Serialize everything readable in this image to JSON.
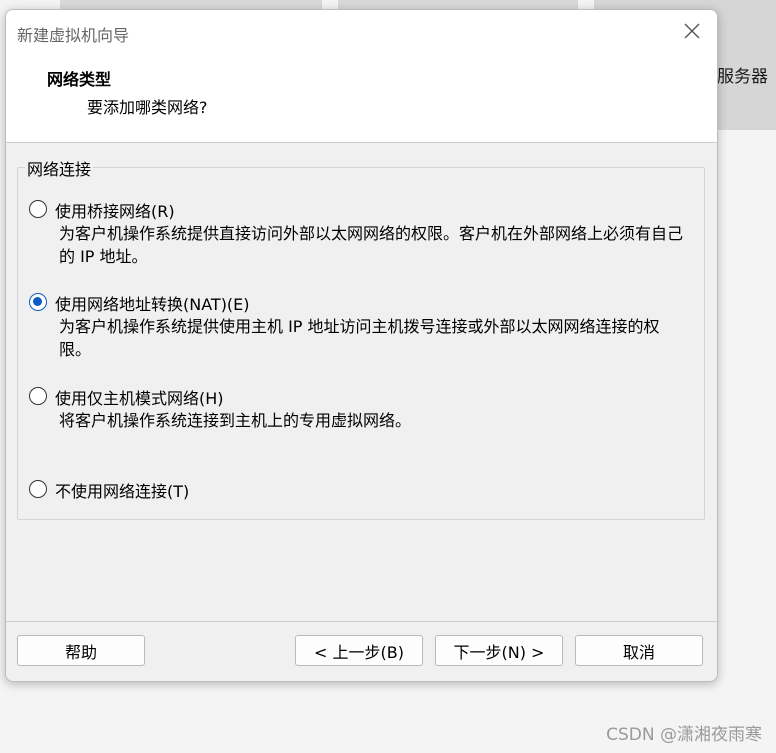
{
  "background": {
    "partial_label": "星服务器",
    "watermark": "CSDN @潇湘夜雨寒"
  },
  "dialog": {
    "title": "新建虚拟机向导",
    "header_title": "网络类型",
    "header_subtitle": "要添加哪类网络?",
    "group_label": "网络连接",
    "options": [
      {
        "label": "使用桥接网络(R)",
        "description": "为客户机操作系统提供直接访问外部以太网网络的权限。客户机在外部网络上必须有自己的 IP 地址。",
        "checked": false
      },
      {
        "label": "使用网络地址转换(NAT)(E)",
        "description": "为客户机操作系统提供使用主机 IP 地址访问主机拨号连接或外部以太网网络连接的权限。",
        "checked": true
      },
      {
        "label": "使用仅主机模式网络(H)",
        "description": "将客户机操作系统连接到主机上的专用虚拟网络。",
        "checked": false
      },
      {
        "label": "不使用网络连接(T)",
        "description": "",
        "checked": false
      }
    ],
    "buttons": {
      "help": "帮助",
      "back": "< 上一步(B)",
      "next": "下一步(N) >",
      "cancel": "取消"
    },
    "accent_color": "#0a5bc4",
    "close_icon": "close-icon"
  }
}
